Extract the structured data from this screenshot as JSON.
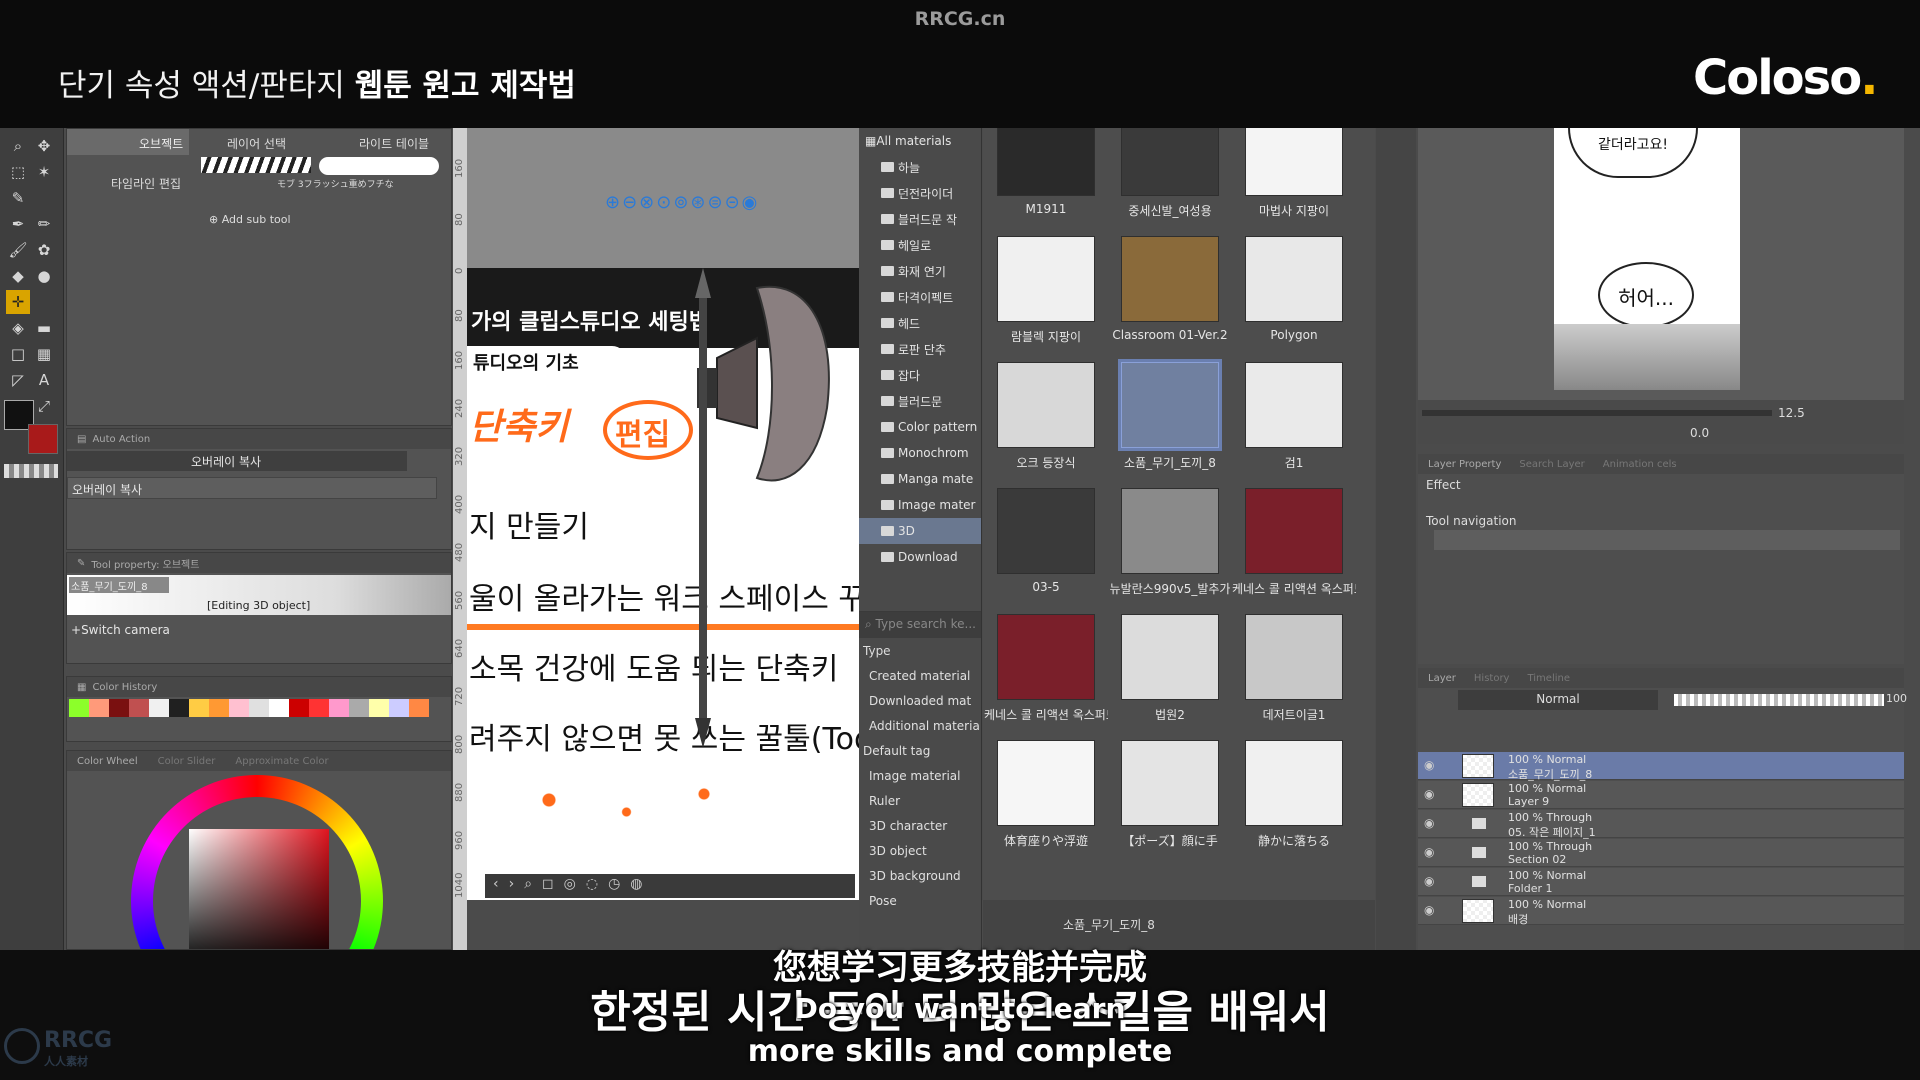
{
  "header": {
    "watermark": "RRCG.cn",
    "course_title_normal": "단기 속성 액션/판타지 ",
    "course_title_bold": "웹툰 원고 제작법",
    "brand": "Coloso",
    "brand_dot": "."
  },
  "subtool": {
    "tabs": [
      "오브젝트",
      "레이어 선택",
      "라이트 테이블",
      "타임라인 편집"
    ],
    "brush_caption": "モブ 3フラッシュ重めフチな",
    "add_sub_tool": "Add sub tool"
  },
  "auto_action": {
    "header": "Auto Action",
    "set_value": "오버레이 복사",
    "item": "오버레이 복사"
  },
  "tool_property": {
    "header": "Tool property: 오브젝트",
    "object_name": "소품_무기_도끼_8",
    "editing_label": "[Editing 3D object]",
    "switch_camera": "Switch camera"
  },
  "color_history": {
    "header": "Color History",
    "colors": [
      "#8cff2a",
      "#ff9a7a",
      "#7a1010",
      "#c05050",
      "#f0f0f0",
      "#202020",
      "#ffcc44",
      "#ff9933",
      "#ffc0d0",
      "#e0e0e0",
      "#ffffff",
      "#cc0000",
      "#ff3333",
      "#ff99cc",
      "#aaaaaa",
      "#ffffaa",
      "#ccccff",
      "#ff8844"
    ]
  },
  "color_wheel": {
    "tabs": [
      "Color Wheel",
      "Color Slider",
      "Approximate Color"
    ],
    "main_color": "#111111",
    "sub_color": "#a81a1a"
  },
  "ruler_ticks": [
    "160",
    "80",
    "0",
    "80",
    "160",
    "240",
    "320",
    "400",
    "480",
    "560",
    "640",
    "720",
    "800",
    "880",
    "960",
    "1040"
  ],
  "canvas": {
    "headline": "가의 클립스튜디오 세팅법",
    "banner": "튜디오의 기초",
    "lines": [
      "지 만들기",
      "울이 올라가는 워크 스페이스 꾸",
      "소목 건강에 도움 되는 단축키",
      "려주지 않으면 못 쓰는 꿀툴(Too"
    ],
    "orange_words": [
      "단축키",
      "편집"
    ]
  },
  "materials": {
    "root": "All materials",
    "tree": [
      "하늘",
      "던전라이더",
      "블러드문 작",
      "헤일로",
      "화재 연기",
      "타격이펙트",
      "헤드",
      "로판 단추",
      "잡다",
      "블러드문",
      "Color pattern",
      "Monochrom",
      "Manga mate",
      "Image mater",
      "3D",
      "Download"
    ],
    "search_placeholder": "Type search ke...",
    "type_header": "Type",
    "type_items": [
      "Created material",
      "Downloaded mat",
      "Additional materia"
    ],
    "default_tag": "Default tag",
    "default_items": [
      "Image material",
      "Ruler",
      "3D character",
      "3D object",
      "3D background",
      "Pose"
    ],
    "selected_name": "소품_무기_도끼_8",
    "items": [
      "M1911",
      "중세신발_여성용",
      "마법사 지팡이",
      "람블렉 지팡이",
      "Classroom 01-Ver.2",
      "Polygon",
      "오크 등장식",
      "소품_무기_도끼_8",
      "검1",
      "03-5",
      "뉴발란스990v5_발추가",
      "케네스 콜 리액션 옥스퍼드",
      "케네스 콜 리액션 옥스퍼드",
      "법원2",
      "데저트이글1",
      "体育座りや浮遊",
      "【ポーズ】顔に手",
      "静かに落ちる"
    ]
  },
  "preview": {
    "bubble1": "같더라고요!",
    "bubble2": "허어...",
    "zoom": "12.5",
    "angle": "0.0"
  },
  "layer_property": {
    "tabs": [
      "Layer Property",
      "Search Layer",
      "Animation cels"
    ],
    "effect": "Effect",
    "tool_navigation": "Tool navigation"
  },
  "layers": {
    "tabs": [
      "Layer",
      "History",
      "Timeline"
    ],
    "blend_mode": "Normal",
    "opacity": "100",
    "rows": [
      {
        "top": "100 % Normal",
        "name": "소품_무기_도끼_8",
        "selected": true,
        "folder": false
      },
      {
        "top": "100 % Normal",
        "name": "Layer 9",
        "selected": false,
        "folder": false
      },
      {
        "top": "100 % Through",
        "name": "05. 작은 페이지_1",
        "selected": false,
        "folder": true
      },
      {
        "top": "100 % Through",
        "name": "Section 02",
        "selected": false,
        "folder": true
      },
      {
        "top": "100 % Normal",
        "name": "Folder 1",
        "selected": false,
        "folder": true
      },
      {
        "top": "100 % Normal",
        "name": "배경",
        "selected": false,
        "folder": false
      }
    ]
  },
  "subtitles": {
    "chinese": "您想学习更多技能并完成",
    "korean": "한정된 시간 동안 더 많은 스킬을 배워서",
    "english_line1": "Do you want to learn",
    "english_line2": "more skills and complete",
    "watermark_text": "RRCG",
    "watermark_sub": "人人素材"
  }
}
